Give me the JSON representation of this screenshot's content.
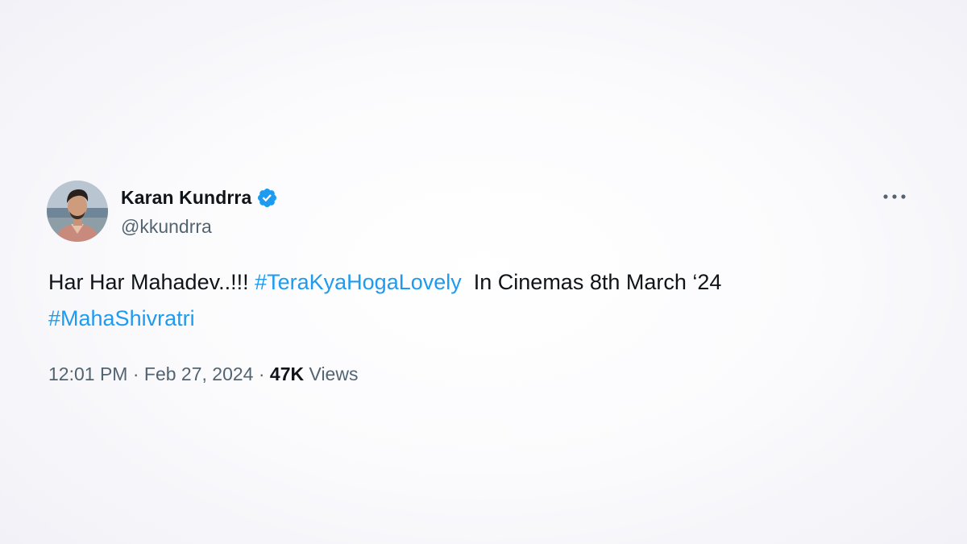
{
  "author": {
    "name": "Karan Kundrra",
    "handle": "@kkundrra",
    "verified": true
  },
  "tweet": {
    "text_part1": "Har Har Mahadev..!!! ",
    "hashtag1": "#TeraKyaHogaLovely",
    "text_part2": "  In Cinemas 8th March ‘24",
    "hashtag2": "#MahaShivratri"
  },
  "meta": {
    "time": "12:01 PM",
    "separator": "·",
    "date": "Feb 27, 2024",
    "views_count": "47K",
    "views_label": "Views"
  },
  "icons": {
    "verified": "verified-badge-icon",
    "more": "more-options-icon"
  },
  "colors": {
    "link": "#1d9bf0",
    "text": "#0f1419",
    "secondary": "#536471",
    "verified": "#1d9bf0"
  }
}
